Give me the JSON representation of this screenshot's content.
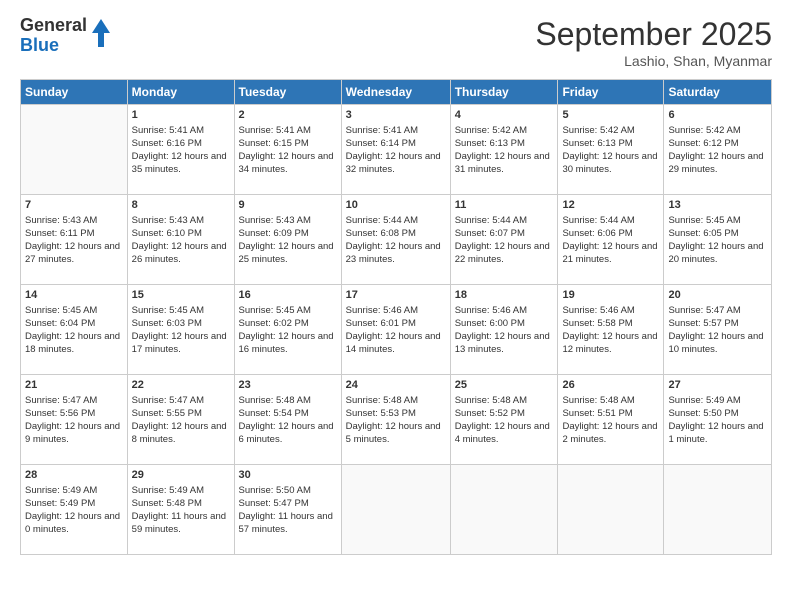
{
  "logo": {
    "general": "General",
    "blue": "Blue"
  },
  "header": {
    "month": "September 2025",
    "location": "Lashio, Shan, Myanmar"
  },
  "weekdays": [
    "Sunday",
    "Monday",
    "Tuesday",
    "Wednesday",
    "Thursday",
    "Friday",
    "Saturday"
  ],
  "weeks": [
    [
      {
        "day": "",
        "empty": true
      },
      {
        "day": "1",
        "sunrise": "5:41 AM",
        "sunset": "6:16 PM",
        "daylight": "12 hours and 35 minutes."
      },
      {
        "day": "2",
        "sunrise": "5:41 AM",
        "sunset": "6:15 PM",
        "daylight": "12 hours and 34 minutes."
      },
      {
        "day": "3",
        "sunrise": "5:41 AM",
        "sunset": "6:14 PM",
        "daylight": "12 hours and 32 minutes."
      },
      {
        "day": "4",
        "sunrise": "5:42 AM",
        "sunset": "6:13 PM",
        "daylight": "12 hours and 31 minutes."
      },
      {
        "day": "5",
        "sunrise": "5:42 AM",
        "sunset": "6:13 PM",
        "daylight": "12 hours and 30 minutes."
      },
      {
        "day": "6",
        "sunrise": "5:42 AM",
        "sunset": "6:12 PM",
        "daylight": "12 hours and 29 minutes."
      }
    ],
    [
      {
        "day": "7",
        "sunrise": "5:43 AM",
        "sunset": "6:11 PM",
        "daylight": "12 hours and 27 minutes."
      },
      {
        "day": "8",
        "sunrise": "5:43 AM",
        "sunset": "6:10 PM",
        "daylight": "12 hours and 26 minutes."
      },
      {
        "day": "9",
        "sunrise": "5:43 AM",
        "sunset": "6:09 PM",
        "daylight": "12 hours and 25 minutes."
      },
      {
        "day": "10",
        "sunrise": "5:44 AM",
        "sunset": "6:08 PM",
        "daylight": "12 hours and 23 minutes."
      },
      {
        "day": "11",
        "sunrise": "5:44 AM",
        "sunset": "6:07 PM",
        "daylight": "12 hours and 22 minutes."
      },
      {
        "day": "12",
        "sunrise": "5:44 AM",
        "sunset": "6:06 PM",
        "daylight": "12 hours and 21 minutes."
      },
      {
        "day": "13",
        "sunrise": "5:45 AM",
        "sunset": "6:05 PM",
        "daylight": "12 hours and 20 minutes."
      }
    ],
    [
      {
        "day": "14",
        "sunrise": "5:45 AM",
        "sunset": "6:04 PM",
        "daylight": "12 hours and 18 minutes."
      },
      {
        "day": "15",
        "sunrise": "5:45 AM",
        "sunset": "6:03 PM",
        "daylight": "12 hours and 17 minutes."
      },
      {
        "day": "16",
        "sunrise": "5:45 AM",
        "sunset": "6:02 PM",
        "daylight": "12 hours and 16 minutes."
      },
      {
        "day": "17",
        "sunrise": "5:46 AM",
        "sunset": "6:01 PM",
        "daylight": "12 hours and 14 minutes."
      },
      {
        "day": "18",
        "sunrise": "5:46 AM",
        "sunset": "6:00 PM",
        "daylight": "12 hours and 13 minutes."
      },
      {
        "day": "19",
        "sunrise": "5:46 AM",
        "sunset": "5:58 PM",
        "daylight": "12 hours and 12 minutes."
      },
      {
        "day": "20",
        "sunrise": "5:47 AM",
        "sunset": "5:57 PM",
        "daylight": "12 hours and 10 minutes."
      }
    ],
    [
      {
        "day": "21",
        "sunrise": "5:47 AM",
        "sunset": "5:56 PM",
        "daylight": "12 hours and 9 minutes."
      },
      {
        "day": "22",
        "sunrise": "5:47 AM",
        "sunset": "5:55 PM",
        "daylight": "12 hours and 8 minutes."
      },
      {
        "day": "23",
        "sunrise": "5:48 AM",
        "sunset": "5:54 PM",
        "daylight": "12 hours and 6 minutes."
      },
      {
        "day": "24",
        "sunrise": "5:48 AM",
        "sunset": "5:53 PM",
        "daylight": "12 hours and 5 minutes."
      },
      {
        "day": "25",
        "sunrise": "5:48 AM",
        "sunset": "5:52 PM",
        "daylight": "12 hours and 4 minutes."
      },
      {
        "day": "26",
        "sunrise": "5:48 AM",
        "sunset": "5:51 PM",
        "daylight": "12 hours and 2 minutes."
      },
      {
        "day": "27",
        "sunrise": "5:49 AM",
        "sunset": "5:50 PM",
        "daylight": "12 hours and 1 minute."
      }
    ],
    [
      {
        "day": "28",
        "sunrise": "5:49 AM",
        "sunset": "5:49 PM",
        "daylight": "12 hours and 0 minutes."
      },
      {
        "day": "29",
        "sunrise": "5:49 AM",
        "sunset": "5:48 PM",
        "daylight": "11 hours and 59 minutes."
      },
      {
        "day": "30",
        "sunrise": "5:50 AM",
        "sunset": "5:47 PM",
        "daylight": "11 hours and 57 minutes."
      },
      {
        "day": "",
        "empty": true
      },
      {
        "day": "",
        "empty": true
      },
      {
        "day": "",
        "empty": true
      },
      {
        "day": "",
        "empty": true
      }
    ]
  ],
  "labels": {
    "sunrise": "Sunrise:",
    "sunset": "Sunset:",
    "daylight": "Daylight:"
  }
}
